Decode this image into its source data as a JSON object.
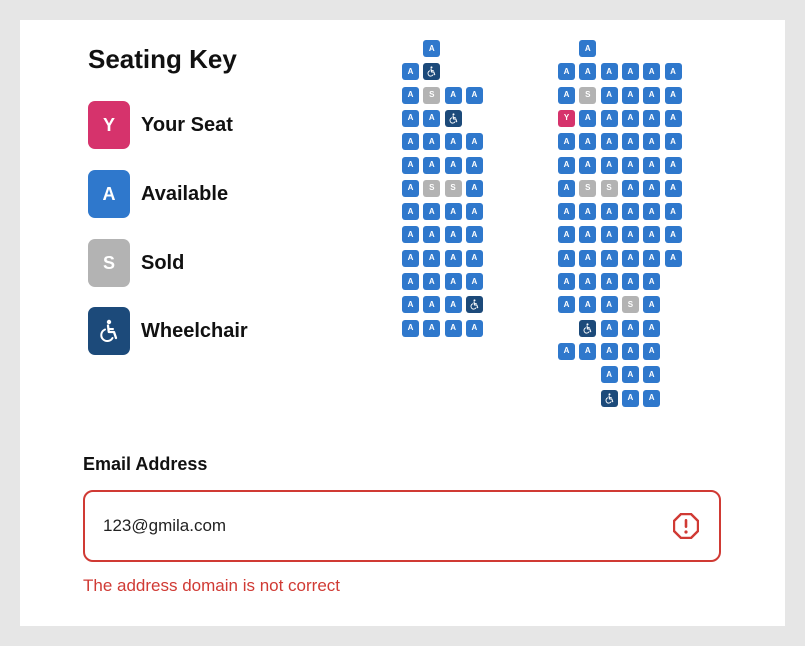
{
  "seating_key": {
    "title": "Seating Key",
    "items": [
      {
        "name": "key-your-seat",
        "letter": "Y",
        "label": "Your Seat",
        "color": "#d6336c",
        "icon": ""
      },
      {
        "name": "key-available",
        "letter": "A",
        "label": "Available",
        "color": "#2f78cc",
        "icon": ""
      },
      {
        "name": "key-sold",
        "letter": "S",
        "label": "Sold",
        "color": "#b3b3b3",
        "icon": ""
      },
      {
        "name": "key-wheelchair",
        "letter": "",
        "label": "Wheelchair",
        "color": "#1c4a7a",
        "icon": "wheelchair-icon"
      }
    ]
  },
  "seat_map": {
    "left_section": [
      "_A__",
      "AW__",
      "ASAA",
      "AAW_",
      "AAAA",
      "AAAA",
      "ASSA",
      "AAAA",
      "AAAA",
      "AAAA",
      "AAAA",
      "AAAW",
      "AAAA"
    ],
    "right_section": [
      "_A____",
      "AAAAAA",
      "ASAAAA",
      "YAAAAA",
      "AAAAAA",
      "AAAAAA",
      "ASSAAA",
      "AAAAAA",
      "AAAAAA",
      "AAAAAA",
      "AAAAA_",
      "AAASA_",
      "_WAAA_",
      "AAAAA_",
      "__AAA_",
      "__WAA_"
    ],
    "seat_letters": {
      "A": "A",
      "S": "S",
      "Y": "Y"
    },
    "colors": {
      "A": "#2f78cc",
      "S": "#b3b3b3",
      "Y": "#d6336c",
      "W": "#1c4a7a"
    }
  },
  "email": {
    "label": "Email Address",
    "value": "123@gmila.com",
    "error": "The address domain is not correct",
    "error_color": "#d03a34"
  }
}
